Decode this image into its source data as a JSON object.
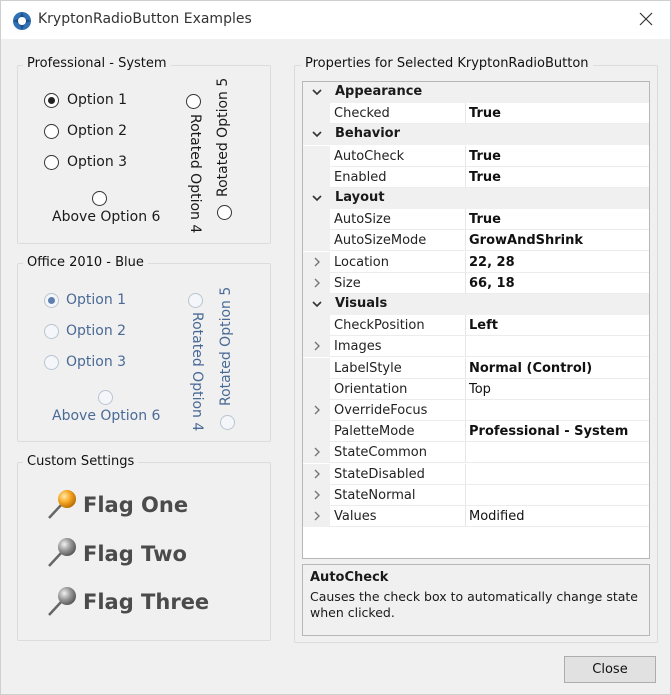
{
  "window": {
    "title": "KryptonRadioButton Examples"
  },
  "group_professional": {
    "title": "Professional - System",
    "options": [
      "Option 1",
      "Option 2",
      "Option 3"
    ],
    "above": "Above Option 6",
    "rot4": "Rotated Option 4",
    "rot5": "Rotated Option 5"
  },
  "group_office": {
    "title": "Office 2010 - Blue",
    "options": [
      "Option 1",
      "Option 2",
      "Option 3"
    ],
    "above": "Above Option 6",
    "rot4": "Rotated Option 4",
    "rot5": "Rotated Option 5"
  },
  "group_custom": {
    "title": "Custom Settings",
    "flags": [
      "Flag One",
      "Flag Two",
      "Flag Three"
    ]
  },
  "properties": {
    "title": "Properties for Selected KryptonRadioButton",
    "rows": [
      {
        "kind": "cat",
        "name": "Appearance"
      },
      {
        "kind": "prop",
        "name": "Checked",
        "value": "True"
      },
      {
        "kind": "cat",
        "name": "Behavior"
      },
      {
        "kind": "prop",
        "name": "AutoCheck",
        "value": "True"
      },
      {
        "kind": "prop",
        "name": "Enabled",
        "value": "True"
      },
      {
        "kind": "cat",
        "name": "Layout"
      },
      {
        "kind": "prop",
        "name": "AutoSize",
        "value": "True"
      },
      {
        "kind": "prop",
        "name": "AutoSizeMode",
        "value": "GrowAndShrink"
      },
      {
        "kind": "prop",
        "name": "Location",
        "value": "22, 28"
      },
      {
        "kind": "prop",
        "name": "Size",
        "value": "66, 18"
      },
      {
        "kind": "cat",
        "name": "Visuals"
      },
      {
        "kind": "prop",
        "name": "CheckPosition",
        "value": "Left"
      },
      {
        "kind": "prop",
        "name": "Images",
        "value": ""
      },
      {
        "kind": "prop",
        "name": "LabelStyle",
        "value": "Normal (Control)"
      },
      {
        "kind": "prop",
        "name": "Orientation",
        "value": "Top"
      },
      {
        "kind": "prop",
        "name": "OverrideFocus",
        "value": ""
      },
      {
        "kind": "prop",
        "name": "PaletteMode",
        "value": "Professional - System"
      },
      {
        "kind": "prop",
        "name": "StateCommon",
        "value": ""
      },
      {
        "kind": "prop",
        "name": "StateDisabled",
        "value": ""
      },
      {
        "kind": "prop",
        "name": "StateNormal",
        "value": ""
      },
      {
        "kind": "prop",
        "name": "Values",
        "value": "Modified"
      }
    ]
  },
  "help": {
    "title": "AutoCheck",
    "description": "Causes the check box to automatically change state when clicked."
  },
  "buttons": {
    "close": "Close"
  }
}
